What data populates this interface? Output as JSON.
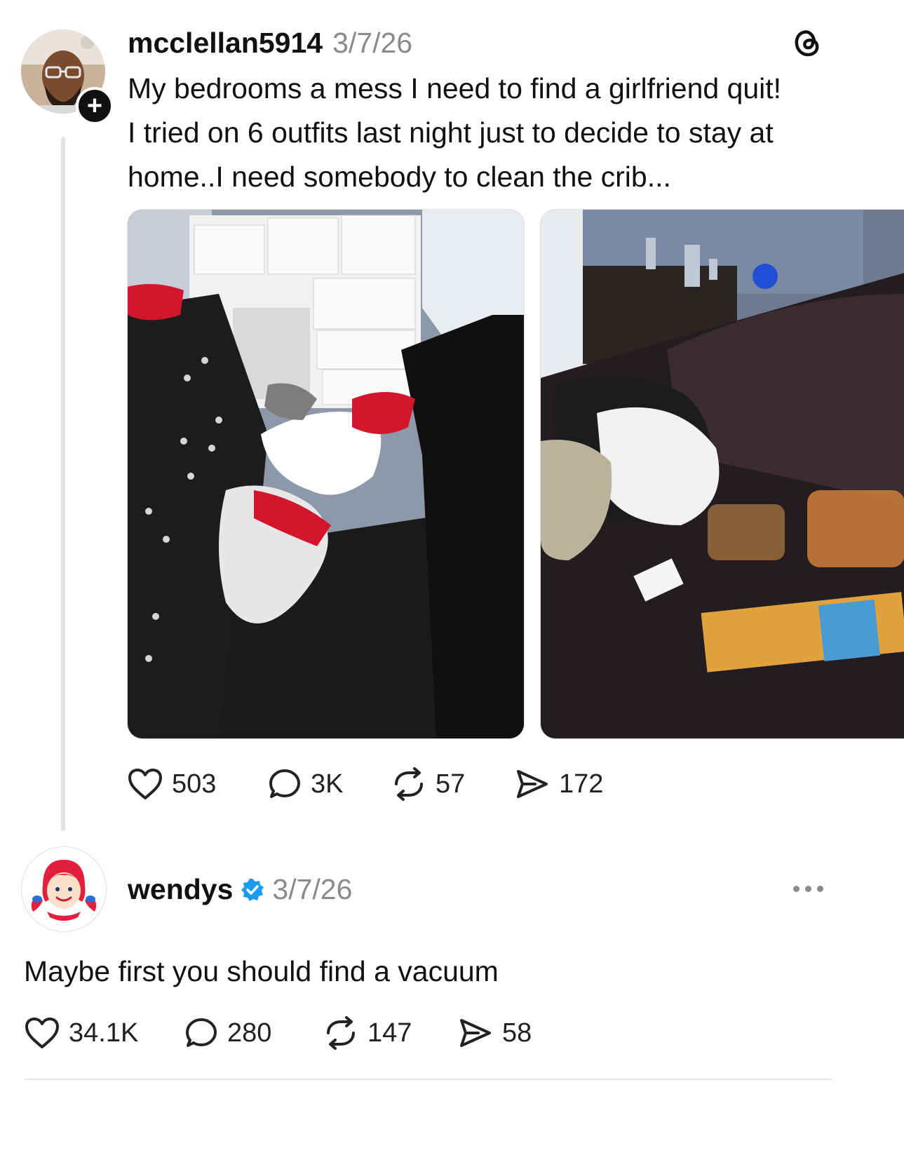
{
  "post": {
    "username": "mcclellan5914",
    "date": "3/7/26",
    "text_lines": [
      "My bedrooms a mess I need to find a girlfriend quit!",
      "I tried on 6 outfits last night just to decide to stay at",
      "home..I need somebody to clean the crib..."
    ],
    "images": [
      {
        "icon": "messy-bedroom-dresser-photo"
      },
      {
        "icon": "messy-bed-clothes-photo"
      }
    ],
    "stats": {
      "likes": "503",
      "replies": "3K",
      "reposts": "57",
      "shares": "172"
    }
  },
  "reply": {
    "username": "wendys",
    "verified": true,
    "date": "3/7/26",
    "text": "Maybe first you should find a vacuum",
    "avatar_text": "Wendy's",
    "stats": {
      "likes": "34.1K",
      "replies": "280",
      "reposts": "147",
      "shares": "58"
    }
  },
  "colors": {
    "text": "#111111",
    "muted": "#8a8a8a",
    "verified": "#1d9bf0",
    "wendys_red": "#e2203d"
  }
}
